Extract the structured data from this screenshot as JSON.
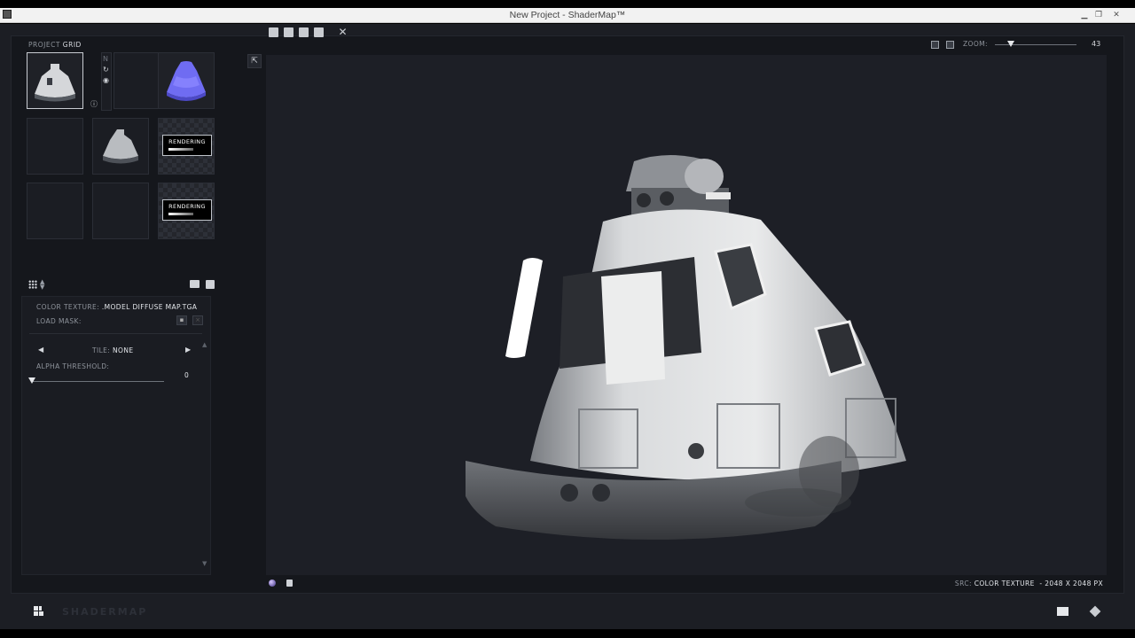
{
  "window": {
    "title": "New Project - ShaderMap™",
    "minimize": "▁",
    "restore": "❐",
    "close": "✕"
  },
  "project": {
    "label": "PROJECT",
    "value": "GRID"
  },
  "slots": [
    {
      "id": "diffuse",
      "state": "image"
    },
    {
      "id": "empty-1",
      "state": "empty"
    },
    {
      "id": "normal",
      "state": "image"
    },
    {
      "id": "empty-2",
      "state": "empty"
    },
    {
      "id": "ao",
      "state": "image"
    },
    {
      "id": "render-1",
      "state": "rendering",
      "label": "RENDERING"
    },
    {
      "id": "empty-3",
      "state": "empty"
    },
    {
      "id": "empty-4",
      "state": "empty"
    },
    {
      "id": "render-2",
      "state": "rendering",
      "label": "RENDERING"
    }
  ],
  "params": {
    "color_texture_label": "COLOR TEXTURE:",
    "color_texture_value": ".MODEL DIFFUSE MAP.TGA",
    "load_mask_label": "LOAD MASK:",
    "tile_label": "TILE:",
    "tile_value": "NONE",
    "alpha_threshold_label": "ALPHA THRESHOLD:",
    "alpha_threshold_value": "0"
  },
  "zoom": {
    "label": "ZOOM:",
    "value": "43",
    "level": 0.17
  },
  "footer": {
    "src_label": "SRC:",
    "src_value": "COLOR TEXTURE",
    "dims": "- 2048 X 2048 PX"
  },
  "brand": "SHADERMAP",
  "icons": {
    "toolbar": [
      "new-file-icon",
      "open-folder-icon",
      "save-icon",
      "save-all-icon",
      "tools-icon"
    ]
  }
}
